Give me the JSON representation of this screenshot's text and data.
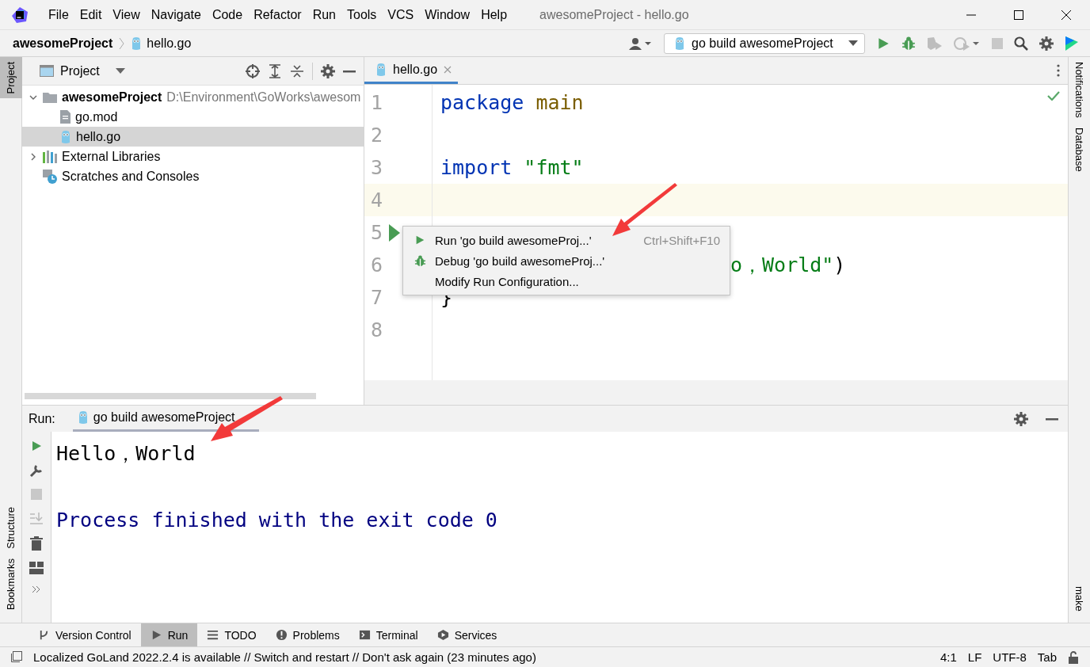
{
  "window": {
    "title": "awesomeProject - hello.go"
  },
  "menu": [
    {
      "label": "File"
    },
    {
      "label": "Edit"
    },
    {
      "label": "View"
    },
    {
      "label": "Navigate"
    },
    {
      "label": "Code"
    },
    {
      "label": "Refactor"
    },
    {
      "label": "Run"
    },
    {
      "label": "Tools"
    },
    {
      "label": "VCS"
    },
    {
      "label": "Window"
    },
    {
      "label": "Help"
    }
  ],
  "breadcrumbs": [
    {
      "label": "awesomeProject",
      "kind": "project"
    },
    {
      "label": "hello.go",
      "kind": "go"
    }
  ],
  "run_config": {
    "label": "go build awesomeProject"
  },
  "left_stripe": [
    {
      "label": "Project",
      "selected": true,
      "kind": "top"
    },
    {
      "label": "Structure",
      "selected": false,
      "kind": "bottom"
    },
    {
      "label": "Bookmarks",
      "selected": false,
      "kind": "bottom"
    }
  ],
  "right_stripe": [
    {
      "label": "Notifications",
      "kind": "top"
    },
    {
      "label": "Database",
      "kind": "top"
    },
    {
      "label": "make",
      "kind": "bottom"
    }
  ],
  "project_panel": {
    "title": "Project",
    "tree": [
      {
        "label": "awesomeProject",
        "path": "D:\\Environment\\GoWorks\\awesom",
        "kind": "folder",
        "expanded": true,
        "selected": false,
        "children": [
          {
            "label": "go.mod",
            "kind": "file",
            "selected": false
          },
          {
            "label": "hello.go",
            "kind": "go",
            "selected": true
          }
        ]
      },
      {
        "label": "External Libraries",
        "kind": "libraries",
        "expanded": false,
        "selected": false
      },
      {
        "label": "Scratches and Consoles",
        "kind": "scratches",
        "selected": false
      }
    ]
  },
  "editor": {
    "tabs": [
      {
        "label": "hello.go",
        "selected": true
      }
    ],
    "lines": [
      {
        "number": "1",
        "current": false,
        "runnable": false,
        "kind": "full",
        "tokens": [
          {
            "text": "package",
            "kind": "keyword",
            "spaced": false
          },
          {
            "text": "main",
            "kind": "name",
            "spaced": true
          }
        ]
      },
      {
        "number": "2",
        "current": false,
        "runnable": false,
        "kind": "full"
      },
      {
        "number": "3",
        "current": false,
        "runnable": false,
        "kind": "full",
        "tokens": [
          {
            "text": "import",
            "kind": "keyword",
            "spaced": false
          },
          {
            "text": "\"fmt\"",
            "kind": "string",
            "spaced": true
          }
        ]
      },
      {
        "number": "4",
        "current": true,
        "runnable": false,
        "kind": "full"
      },
      {
        "number": "5",
        "current": false,
        "runnable": true,
        "kind": "full"
      },
      {
        "number": "6",
        "current": false,
        "runnable": false,
        "kind": "partial",
        "tokens": [
          {
            "text": "o，World\"",
            "kind": "string",
            "spaced": false
          },
          {
            "text": ")",
            "spaced": false
          }
        ]
      },
      {
        "number": "7",
        "current": false,
        "runnable": false,
        "kind": "full",
        "tokens": [
          {
            "text": "}",
            "spaced": false
          }
        ]
      },
      {
        "number": "8",
        "current": false,
        "runnable": false,
        "kind": "full"
      }
    ],
    "popup": [
      {
        "kind": "run",
        "label": "Run 'go build awesomeProj...'",
        "shortcut": "Ctrl+Shift+F10"
      },
      {
        "kind": "debug",
        "label": "Debug 'go build awesomeProj...'"
      },
      {
        "kind": "plain",
        "label": "Modify Run Configuration..."
      }
    ]
  },
  "run_panel": {
    "label": "Run:",
    "tab": "go build awesomeProject",
    "output": [
      {
        "text": "Hello，World",
        "kind": "stdout"
      },
      {
        "text": "Process finished with the exit code 0",
        "kind": "system"
      }
    ]
  },
  "bottom_tabs": [
    {
      "label": "Version Control",
      "kind": "vcs",
      "selected": false
    },
    {
      "label": "Run",
      "kind": "run",
      "selected": true
    },
    {
      "label": "TODO",
      "kind": "todo",
      "selected": false
    },
    {
      "label": "Problems",
      "kind": "problems",
      "selected": false
    },
    {
      "label": "Terminal",
      "kind": "terminal",
      "selected": false
    },
    {
      "label": "Services",
      "kind": "services",
      "selected": false
    }
  ],
  "status_bar": {
    "message": "Localized GoLand 2022.2.4 is available // Switch and restart // Don't ask again (23 minutes ago)",
    "items": [
      "4:1",
      "LF",
      "UTF-8",
      "Tab"
    ]
  }
}
